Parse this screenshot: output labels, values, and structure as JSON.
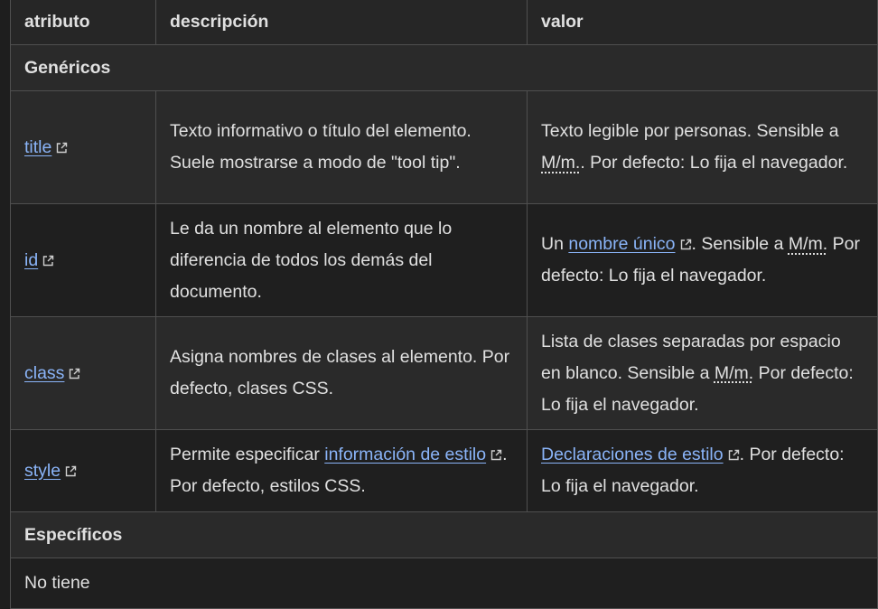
{
  "headers": {
    "atributo": "atributo",
    "descripcion": "descripción",
    "valor": "valor"
  },
  "sections": {
    "genericos": "Genéricos",
    "especificos": "Específicos",
    "especificos_value": "No tiene"
  },
  "rows": [
    {
      "attr": "title",
      "desc": "Texto informativo o título del elemento. Suele mostrarse a modo de \"tool tip\".",
      "valor_pre": "Texto legible por personas. Sensible a ",
      "valor_abbr": "M/m.",
      "valor_post": ". Por defecto: Lo fija el navegador."
    },
    {
      "attr": "id",
      "desc": "Le da un nombre al elemento que lo diferencia de todos los demás del documento.",
      "valor_pre": "Un ",
      "valor_link": "nombre único",
      "valor_mid": ". Sensible a ",
      "valor_abbr": "M/m.",
      "valor_post": " Por defecto: Lo fija el navegador."
    },
    {
      "attr": "class",
      "desc": "Asigna nombres de clases al elemento. Por defecto, clases CSS.",
      "valor_pre": "Lista de clases separadas por espacio en blanco. Sensible a ",
      "valor_abbr": "M/m.",
      "valor_post": " Por defecto: Lo fija el navegador."
    },
    {
      "attr": "style",
      "desc_pre": "Permite especificar ",
      "desc_link": "información de estilo",
      "desc_post": ". Por defecto, estilos CSS.",
      "valor_link": "Declaraciones de estilo",
      "valor_post": ". Por defecto: Lo fija el navegador."
    }
  ],
  "colors": {
    "link": "#8ab4f8",
    "background": "#1e1e1e"
  },
  "icons": {
    "external": "external-link-icon"
  }
}
